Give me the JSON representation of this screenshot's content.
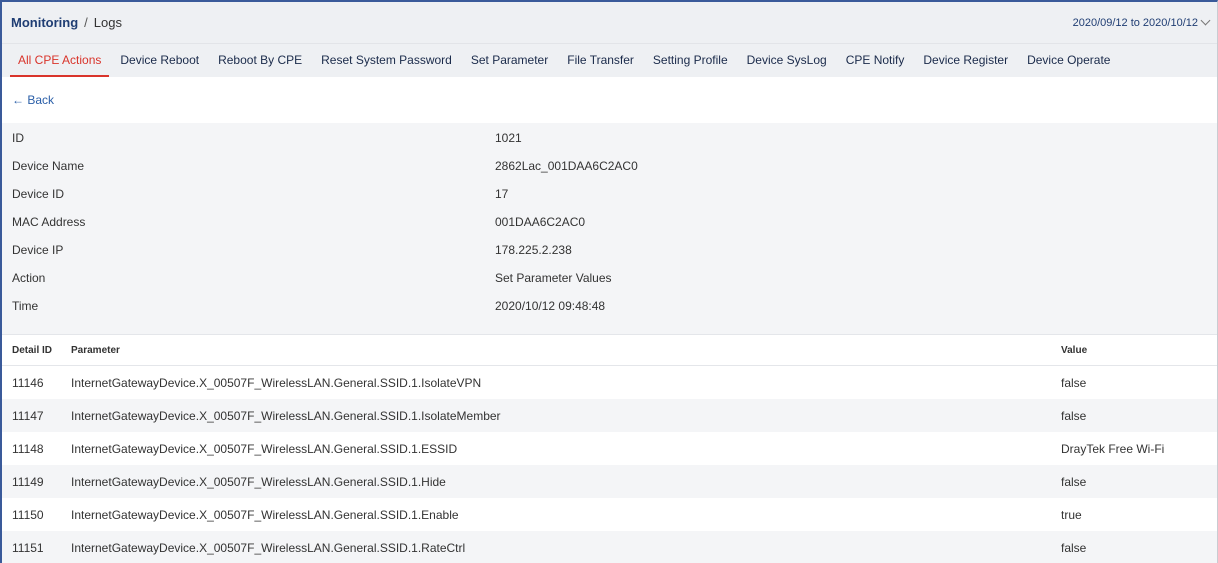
{
  "header": {
    "breadcrumb_main": "Monitoring",
    "breadcrumb_sep": "/",
    "breadcrumb_sub": "Logs",
    "date_range": "2020/09/12 to 2020/10/12"
  },
  "tabs": [
    {
      "label": "All CPE Actions",
      "active": true
    },
    {
      "label": "Device Reboot"
    },
    {
      "label": "Reboot By CPE"
    },
    {
      "label": "Reset System Password"
    },
    {
      "label": "Set Parameter"
    },
    {
      "label": "File Transfer"
    },
    {
      "label": "Setting Profile"
    },
    {
      "label": "Device SysLog"
    },
    {
      "label": "CPE Notify"
    },
    {
      "label": "Device Register"
    },
    {
      "label": "Device Operate"
    }
  ],
  "back_label": "← Back",
  "info": [
    {
      "label": "ID",
      "value": "1021"
    },
    {
      "label": "Device Name",
      "value": "2862Lac_001DAA6C2AC0"
    },
    {
      "label": "Device ID",
      "value": "17"
    },
    {
      "label": "MAC Address",
      "value": "001DAA6C2AC0"
    },
    {
      "label": "Device IP",
      "value": "178.225.2.238"
    },
    {
      "label": "Action",
      "value": "Set Parameter Values"
    },
    {
      "label": "Time",
      "value": "2020/10/12 09:48:48"
    }
  ],
  "table": {
    "headers": [
      "Detail ID",
      "Parameter",
      "Value"
    ],
    "rows": [
      [
        "11146",
        "InternetGatewayDevice.X_00507F_WirelessLAN.General.SSID.1.IsolateVPN",
        "false"
      ],
      [
        "11147",
        "InternetGatewayDevice.X_00507F_WirelessLAN.General.SSID.1.IsolateMember",
        "false"
      ],
      [
        "11148",
        "InternetGatewayDevice.X_00507F_WirelessLAN.General.SSID.1.ESSID",
        "DrayTek Free Wi-Fi"
      ],
      [
        "11149",
        "InternetGatewayDevice.X_00507F_WirelessLAN.General.SSID.1.Hide",
        "false"
      ],
      [
        "11150",
        "InternetGatewayDevice.X_00507F_WirelessLAN.General.SSID.1.Enable",
        "true"
      ],
      [
        "11151",
        "InternetGatewayDevice.X_00507F_WirelessLAN.General.SSID.1.RateCtrl",
        "false"
      ]
    ]
  },
  "colors": {
    "accent": "#d9342b",
    "brand": "#1f3d73",
    "link": "#2b5fa8"
  }
}
